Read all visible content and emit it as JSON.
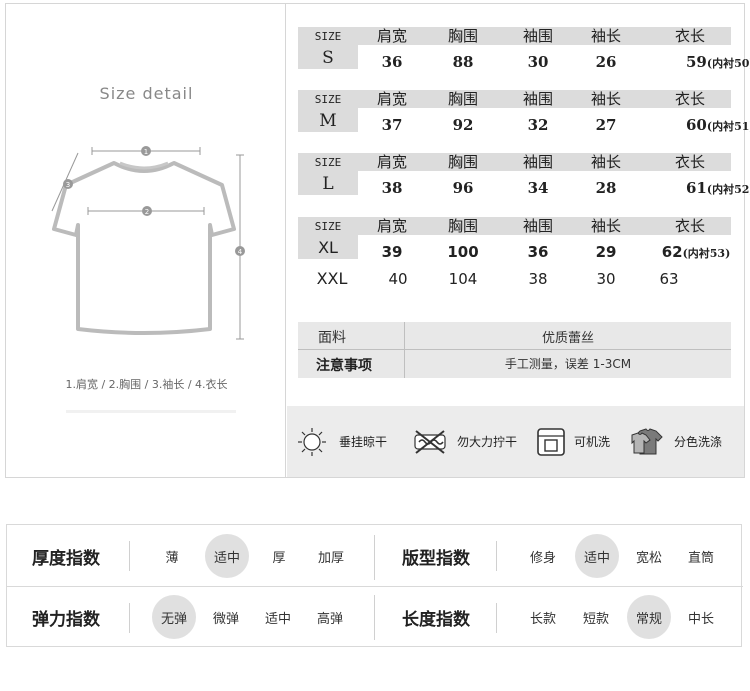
{
  "left_panel": {
    "title": "Size detail",
    "legend": "1.肩宽 / 2.胸围 / 3.袖长 / 4.衣长",
    "markers": [
      "1",
      "2",
      "3",
      "4"
    ]
  },
  "size_table": {
    "size_word": "SIZE",
    "headers": [
      "肩宽",
      "胸围",
      "袖围",
      "袖长",
      "衣长"
    ],
    "rows": [
      {
        "size": "S",
        "values": [
          "36",
          "88",
          "30",
          "26",
          "59"
        ],
        "lining": "(内衬50)"
      },
      {
        "size": "M",
        "values": [
          "37",
          "92",
          "32",
          "27",
          "60"
        ],
        "lining": "(内衬51)"
      },
      {
        "size": "L",
        "values": [
          "38",
          "96",
          "34",
          "28",
          "61"
        ],
        "lining": "(内衬52)"
      },
      {
        "size": "XL",
        "values": [
          "39",
          "100",
          "36",
          "29",
          "62"
        ],
        "lining": "(内衬53)"
      },
      {
        "size": "XXL",
        "values": [
          "40",
          "104",
          "38",
          "30",
          "63"
        ]
      }
    ]
  },
  "fabric": {
    "label": "面料",
    "value": "优质蕾丝",
    "note_label": "注意事项",
    "note_value": "手工测量，误差 1-3CM"
  },
  "care": [
    {
      "icon": "sun-icon",
      "label": "垂挂晾干"
    },
    {
      "icon": "no-wring-icon",
      "label": "勿大力拧干"
    },
    {
      "icon": "washing-machine-icon",
      "label": "可机洗"
    },
    {
      "icon": "shirt-color-icon",
      "label": "分色洗涤"
    }
  ],
  "indices": {
    "thickness": {
      "title": "厚度指数",
      "options": [
        "薄",
        "适中",
        "厚",
        "加厚"
      ],
      "selected": "适中"
    },
    "fit": {
      "title": "版型指数",
      "options": [
        "修身",
        "适中",
        "宽松",
        "直筒"
      ],
      "selected": "适中"
    },
    "stretch": {
      "title": "弹力指数",
      "options": [
        "无弹",
        "微弹",
        "适中",
        "高弹"
      ],
      "selected": "无弹"
    },
    "length": {
      "title": "长度指数",
      "options": [
        "长款",
        "短款",
        "常规",
        "中长"
      ],
      "selected": "常规"
    }
  },
  "colors": {
    "highlight": "#e0e0e0",
    "header_bar": "#dcdcdc",
    "border": "#d6d6d6"
  }
}
